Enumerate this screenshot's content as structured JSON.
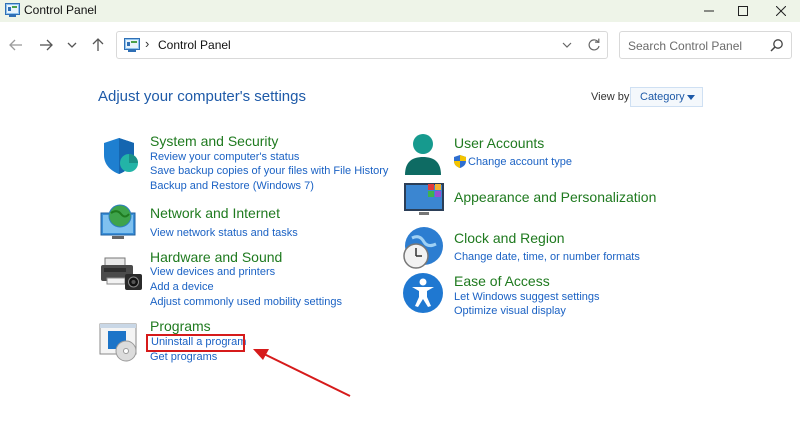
{
  "window": {
    "title": "Control Panel"
  },
  "address_bar": {
    "separator": "›",
    "path": "Control Panel"
  },
  "search": {
    "placeholder": "Search Control Panel"
  },
  "content": {
    "heading": "Adjust your computer's settings",
    "view_by_label": "View by:",
    "view_by_value": "Category"
  },
  "categories": {
    "system_security": {
      "title": "System and Security",
      "links": [
        "Review your computer's status",
        "Save backup copies of your files with File History",
        "Backup and Restore (Windows 7)"
      ]
    },
    "network_internet": {
      "title": "Network and Internet",
      "links": [
        "View network status and tasks"
      ]
    },
    "hardware_sound": {
      "title": "Hardware and Sound",
      "links": [
        "View devices and printers",
        "Add a device",
        "Adjust commonly used mobility settings"
      ]
    },
    "programs": {
      "title": "Programs",
      "links": [
        "Uninstall a program",
        "Get programs"
      ]
    },
    "user_accounts": {
      "title": "User Accounts",
      "links": [
        "Change account type"
      ]
    },
    "appearance": {
      "title": "Appearance and Personalization",
      "links": []
    },
    "clock_region": {
      "title": "Clock and Region",
      "links": [
        "Change date, time, or number formats"
      ]
    },
    "ease_access": {
      "title": "Ease of Access",
      "links": [
        "Let Windows suggest settings",
        "Optimize visual display"
      ]
    }
  },
  "annotation": {
    "highlight_color": "#d61b1b"
  },
  "colors": {
    "category_title": "#1f7a1f",
    "link": "#1b62c4",
    "heading": "#1e5aa8"
  }
}
